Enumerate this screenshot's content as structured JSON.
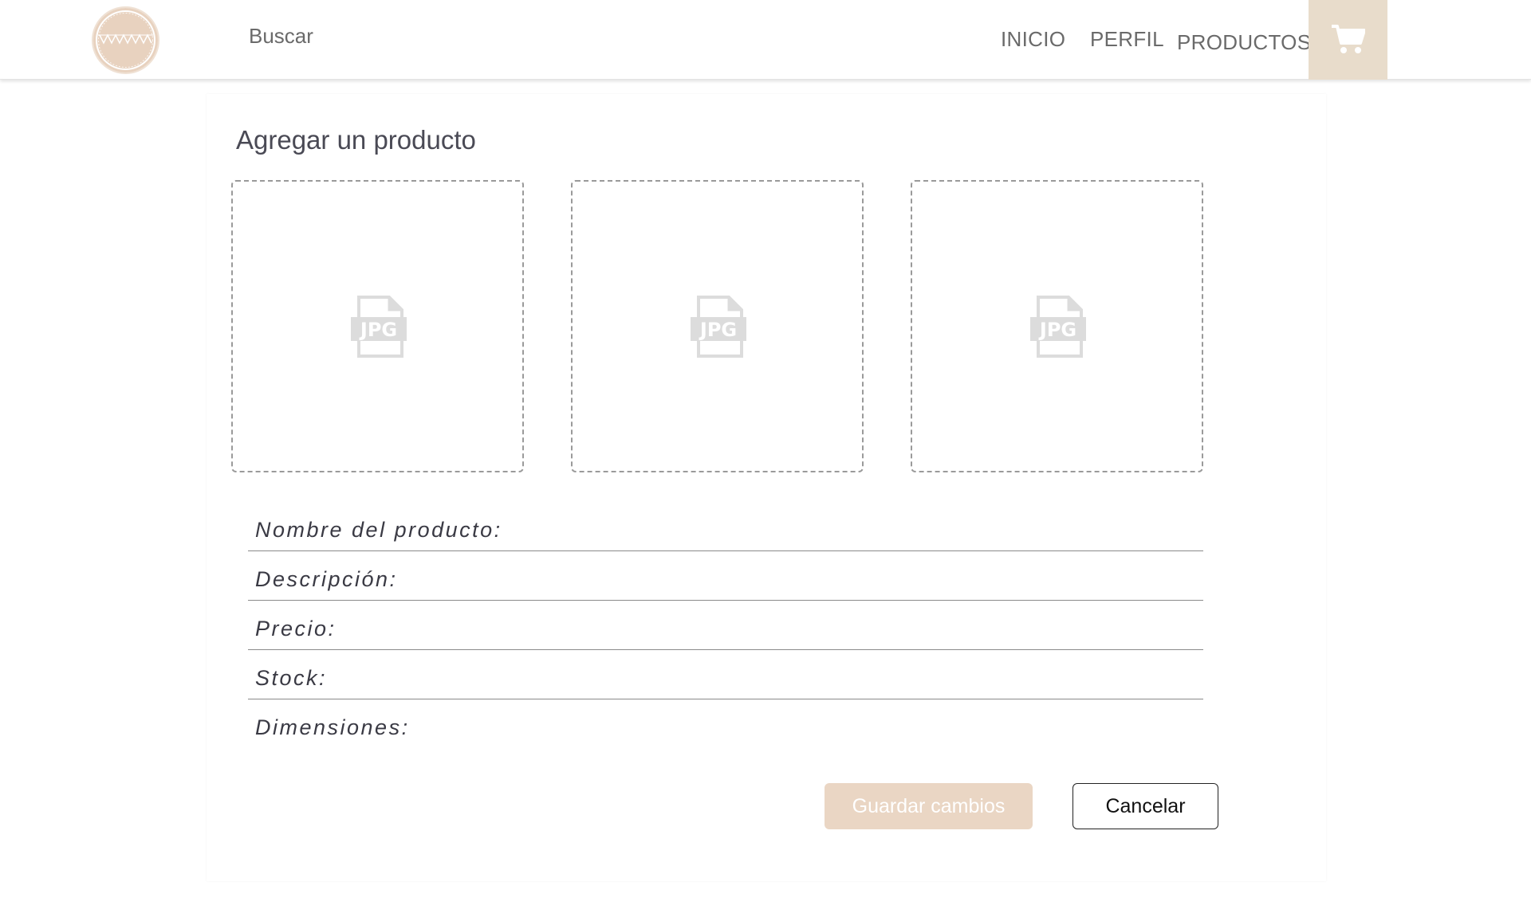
{
  "header": {
    "search_label": "Buscar",
    "nav": {
      "inicio": "INICIO",
      "perfil": "PERFIL",
      "productos": "PRODUCTOS"
    }
  },
  "form": {
    "title": "Agregar un producto",
    "upload_icon_text": "JPG",
    "fields": {
      "nombre": {
        "label": "Nombre del producto:",
        "value": ""
      },
      "descripcion": {
        "label": "Descripción:",
        "value": ""
      },
      "precio": {
        "label": "Precio:",
        "value": ""
      },
      "stock": {
        "label": "Stock:",
        "value": ""
      },
      "dimensiones": {
        "label": "Dimensiones:",
        "value": ""
      }
    },
    "save_label": "Guardar cambios",
    "cancel_label": "Cancelar"
  },
  "colors": {
    "accent": "#e8dccb",
    "logo": "#e8d2bf",
    "save_button": "#ead6c4"
  },
  "icons": {
    "cart": "cart-icon",
    "upload": "jpg-file-icon"
  }
}
